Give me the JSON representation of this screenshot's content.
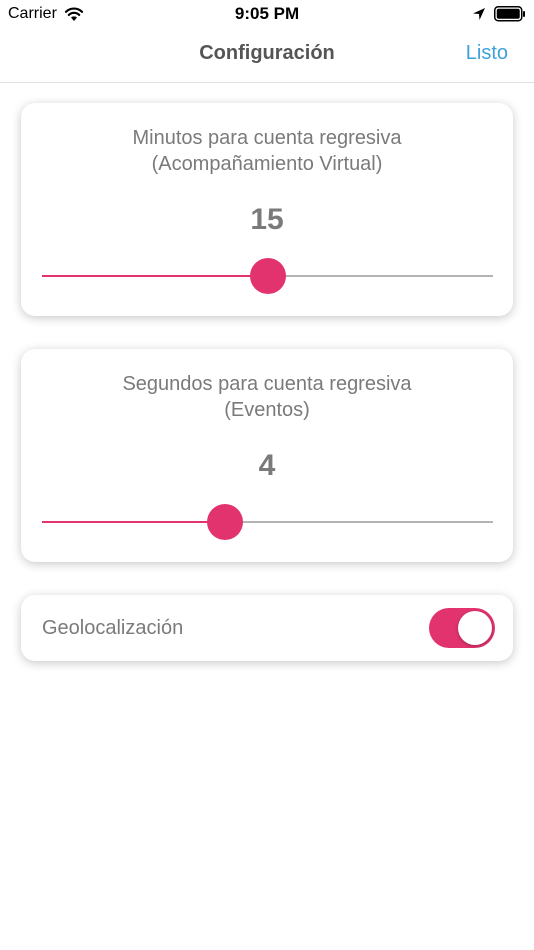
{
  "status_bar": {
    "carrier": "Carrier",
    "time": "9:05 PM",
    "icons": [
      "wifi-icon",
      "location-icon",
      "battery-icon"
    ]
  },
  "nav": {
    "title": "Configuración",
    "done_label": "Listo"
  },
  "colors": {
    "accent": "#e2336e",
    "link": "#3ea1d8",
    "text_muted": "#7a7a7a",
    "track": "#b4b4b4"
  },
  "settings": {
    "minutes": {
      "label_line1": "Minutos para cuenta regresiva",
      "label_line2": "(Acompañamiento Virtual)",
      "value": "15",
      "slider_fraction": 0.5
    },
    "seconds": {
      "label_line1": "Segundos para cuenta regresiva",
      "label_line2": "(Eventos)",
      "value": "4",
      "slider_fraction": 0.405
    },
    "geolocation": {
      "label": "Geolocalización",
      "enabled": true
    }
  }
}
